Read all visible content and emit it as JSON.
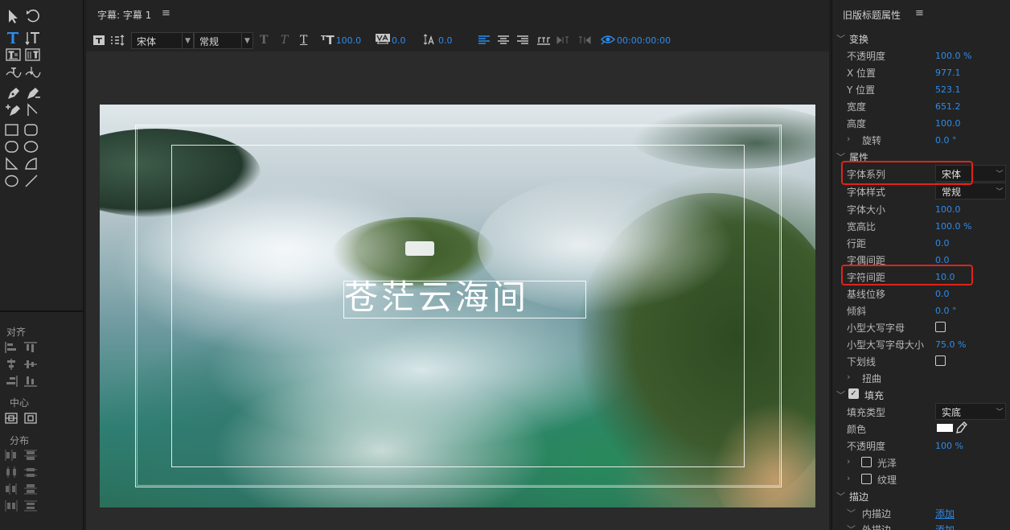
{
  "center": {
    "tab_title": "字幕: 字幕 1",
    "menu_icon": "≡",
    "toolbar": {
      "font_family": "宋体",
      "font_style": "常规",
      "font_size": "100.0",
      "kerning": "0.0",
      "leading": "0.0",
      "timecode": "00:00:00:00"
    },
    "caption_text": "苍茫云海间"
  },
  "left": {
    "align_label": "对齐",
    "center_label": "中心",
    "distribute_label": "分布"
  },
  "props": {
    "title": "旧版标题属性",
    "menu_icon": "≡",
    "transform": {
      "label": "变换",
      "rows": [
        {
          "label": "不透明度",
          "value": "100.0 %"
        },
        {
          "label": "X 位置",
          "value": "977.1"
        },
        {
          "label": "Y 位置",
          "value": "523.1"
        },
        {
          "label": "宽度",
          "value": "651.2"
        },
        {
          "label": "高度",
          "value": "100.0"
        }
      ],
      "rotation": {
        "label": "旋转",
        "value": "0.0 °"
      }
    },
    "attributes": {
      "label": "属性",
      "font_family": {
        "label": "字体系列",
        "value": "宋体"
      },
      "font_style": {
        "label": "字体样式",
        "value": "常规"
      },
      "rows": [
        {
          "label": "字体大小",
          "value": "100.0"
        },
        {
          "label": "宽高比",
          "value": "100.0 %"
        },
        {
          "label": "行距",
          "value": "0.0"
        },
        {
          "label": "字偶间距",
          "value": "0.0"
        },
        {
          "label": "字符间距",
          "value": "10.0"
        },
        {
          "label": "基线位移",
          "value": "0.0"
        },
        {
          "label": "倾斜",
          "value": "0.0 °"
        }
      ],
      "small_caps": {
        "label": "小型大写字母"
      },
      "small_caps_size": {
        "label": "小型大写字母大小",
        "value": "75.0 %"
      },
      "underline": {
        "label": "下划线"
      },
      "distort": {
        "label": "扭曲"
      }
    },
    "fill": {
      "label": "填充",
      "type": {
        "label": "填充类型",
        "value": "实底"
      },
      "color": {
        "label": "颜色",
        "swatch": "#ffffff"
      },
      "opacity": {
        "label": "不透明度",
        "value": "100 %"
      },
      "sheen": {
        "label": "光泽"
      },
      "texture": {
        "label": "纹理"
      }
    },
    "stroke": {
      "label": "描边",
      "inner": {
        "label": "内描边",
        "action": "添加"
      },
      "outer": {
        "label": "外描边",
        "action": "添加"
      }
    }
  },
  "colors": {
    "accent": "#2d8ceb",
    "highlight": "#e0231b",
    "panel_bg": "#232323"
  }
}
